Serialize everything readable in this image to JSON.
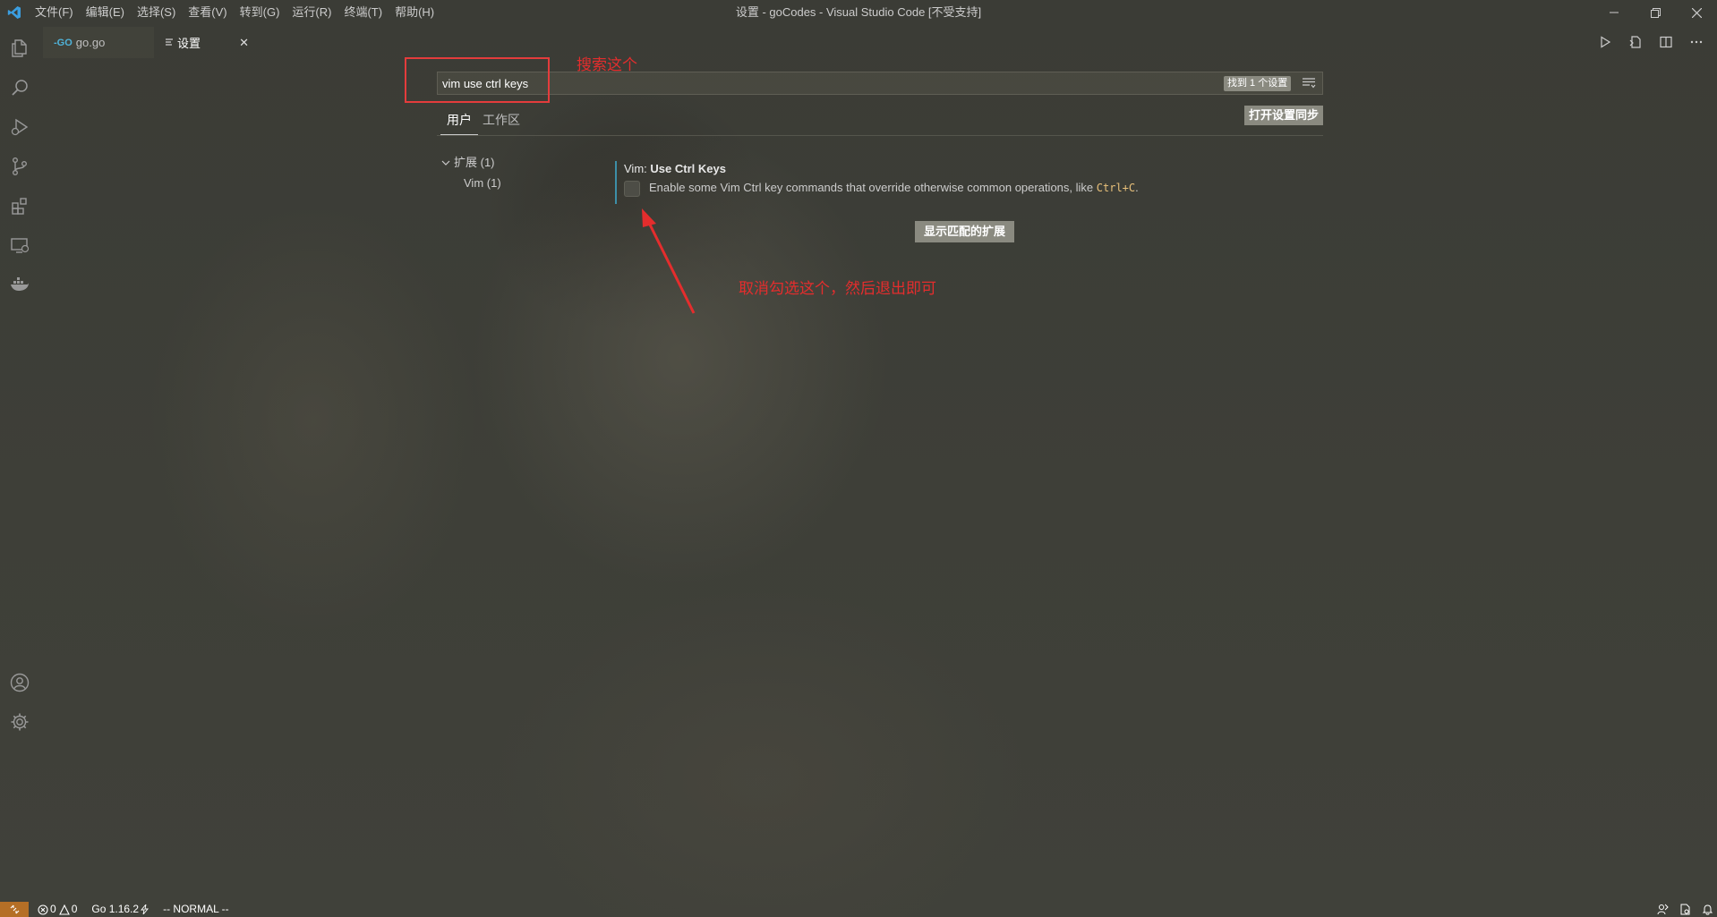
{
  "titlebar": {
    "menu": [
      "文件(F)",
      "编辑(E)",
      "选择(S)",
      "查看(V)",
      "转到(G)",
      "运行(R)",
      "终端(T)",
      "帮助(H)"
    ],
    "window_title": "设置 - goCodes - Visual Studio Code [不受支持]"
  },
  "tabs": [
    {
      "label": "go.go",
      "icon": "go-file-icon"
    },
    {
      "label": "设置",
      "icon": "settings-file-icon",
      "close": "✕"
    }
  ],
  "settings": {
    "search_value": "vim use ctrl keys",
    "found_badge": "找到 1 个设置",
    "scope_tabs": [
      "用户",
      "工作区"
    ],
    "sync_button": "打开设置同步",
    "toc": {
      "group": "扩展 (1)",
      "item": "Vim (1)"
    },
    "item": {
      "category": "Vim: ",
      "key": "Use Ctrl Keys",
      "checked": false,
      "description_pre": "Enable some Vim Ctrl key commands that override otherwise common operations, like ",
      "description_code": "Ctrl+C",
      "description_post": "."
    },
    "show_extensions_button": "显示匹配的扩展"
  },
  "annotations": {
    "search_note": "搜索这个",
    "uncheck_note": "取消勾选这个，然后退出即可",
    "color": "#e42d2d"
  },
  "statusbar": {
    "errors": "0",
    "warnings": "0",
    "go_version": "Go 1.16.2",
    "vim_mode": "-- NORMAL --",
    "remote_color": "#b56f26"
  }
}
